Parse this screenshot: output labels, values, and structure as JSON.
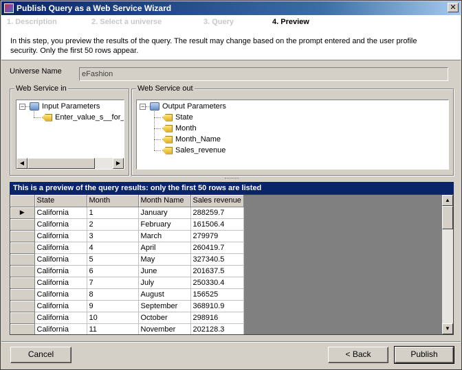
{
  "window": {
    "title": "Publish Query as a Web Service Wizard",
    "close_glyph": "✕"
  },
  "steps": [
    {
      "label": "1. Description"
    },
    {
      "label": "2. Select a universe"
    },
    {
      "label": "3. Query"
    },
    {
      "label": "4. Preview"
    }
  ],
  "description": "In this step, you preview the results of the query. The result may change based on the prompt entered and the user profile security. Only the first 50 rows appear.",
  "universe": {
    "label": "Universe Name",
    "value": "eFashion"
  },
  "ws_in": {
    "legend": "Web Service in",
    "root": "Input Parameters",
    "children": [
      "Enter_value_s__for_"
    ],
    "expander": "−"
  },
  "ws_out": {
    "legend": "Web Service out",
    "root": "Output Parameters",
    "children": [
      "State",
      "Month",
      "Month_Name",
      "Sales_revenue"
    ],
    "expander": "−"
  },
  "preview": {
    "title": "This is a preview of the query results: only the first 50 rows are listed",
    "columns": [
      "State",
      "Month",
      "Month Name",
      "Sales revenue"
    ],
    "current_row_marker": "▶",
    "rows": [
      [
        "California",
        "1",
        "January",
        "288259.7"
      ],
      [
        "California",
        "2",
        "February",
        "161506.4"
      ],
      [
        "California",
        "3",
        "March",
        "279979"
      ],
      [
        "California",
        "4",
        "April",
        "260419.7"
      ],
      [
        "California",
        "5",
        "May",
        "327340.5"
      ],
      [
        "California",
        "6",
        "June",
        "201637.5"
      ],
      [
        "California",
        "7",
        "July",
        "250330.4"
      ],
      [
        "California",
        "8",
        "August",
        "156525"
      ],
      [
        "California",
        "9",
        "September",
        "368910.9"
      ],
      [
        "California",
        "10",
        "October",
        "298916"
      ],
      [
        "California",
        "11",
        "November",
        "202128.3"
      ]
    ]
  },
  "scroll": {
    "left": "◀",
    "right": "▶",
    "up": "▲",
    "down": "▼"
  },
  "buttons": {
    "cancel": "Cancel",
    "back": "< Back",
    "publish": "Publish"
  }
}
